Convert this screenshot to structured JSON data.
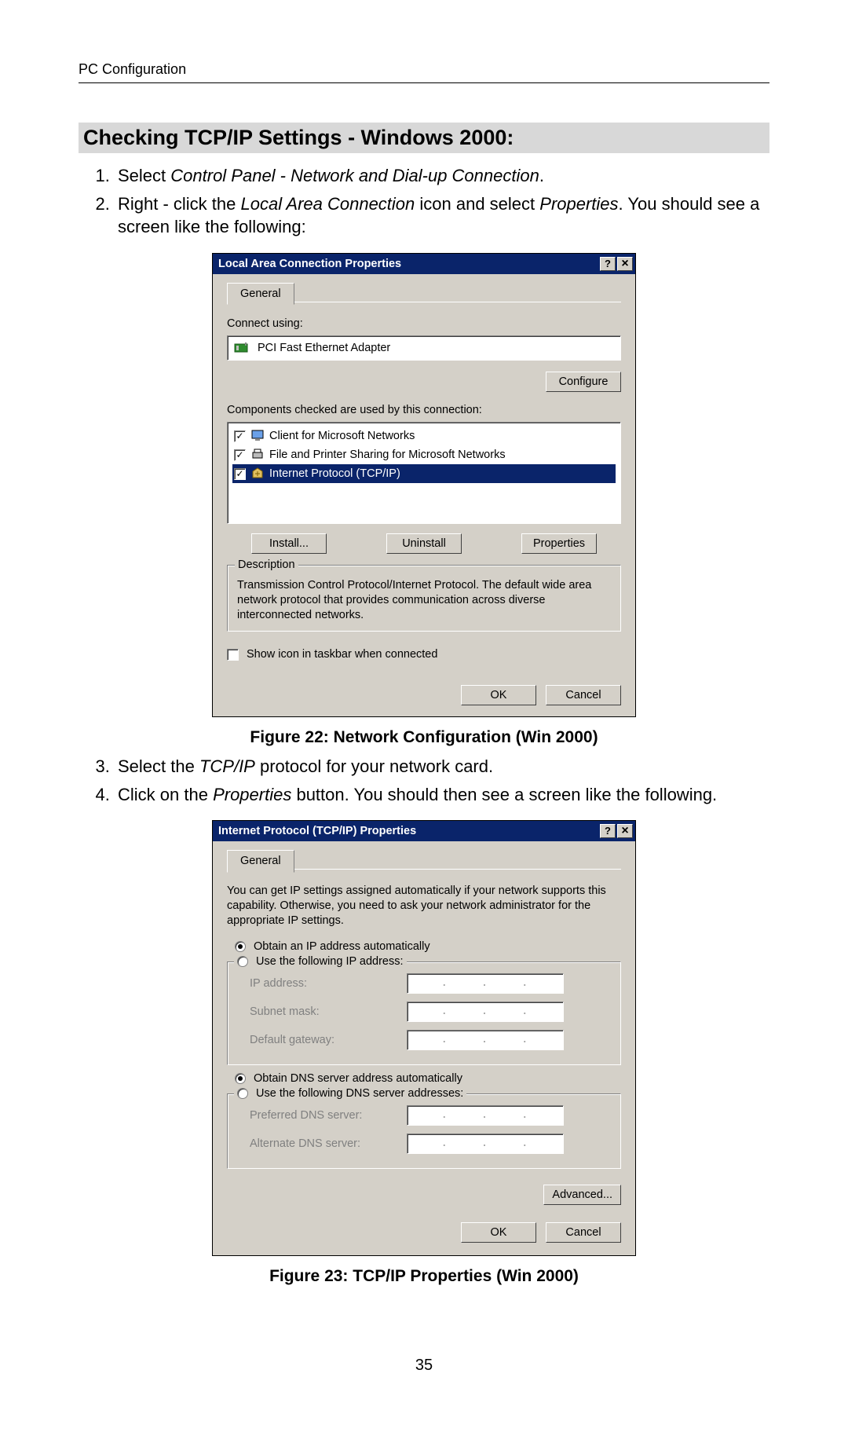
{
  "header": {
    "running": "PC Configuration"
  },
  "heading": "Checking TCP/IP Settings - Windows 2000:",
  "steps1": {
    "s1a": "Select ",
    "s1b": "Control Panel - Network and Dial-up Connection",
    "s1c": ".",
    "s2a": "Right - click the ",
    "s2b": "Local Area Connection",
    "s2c": " icon and select ",
    "s2d": "Properties",
    "s2e": ". You should see a screen like the following:"
  },
  "fig22": "Figure 22: Network Configuration (Win 2000)",
  "steps2": {
    "s3a": "Select the ",
    "s3b": "TCP/IP",
    "s3c": " protocol for your network card.",
    "s4a": "Click on the ",
    "s4b": "Properties",
    "s4c": " button. You should then see a screen like the following."
  },
  "fig23": "Figure 23: TCP/IP Properties (Win 2000)",
  "pagenum": "35",
  "dlg1": {
    "title": "Local Area Connection Properties",
    "tab": "General",
    "connectUsing": "Connect using:",
    "adapter": "PCI Fast Ethernet Adapter",
    "configure": "Configure",
    "componentsLabel": "Components checked are used by this connection:",
    "items": {
      "a": "Client for Microsoft Networks",
      "b": "File and Printer Sharing for Microsoft Networks",
      "c": "Internet Protocol (TCP/IP)"
    },
    "install": "Install...",
    "uninstall": "Uninstall",
    "properties": "Properties",
    "descLegend": "Description",
    "descText": "Transmission Control Protocol/Internet Protocol. The default wide area network protocol that provides communication across diverse interconnected networks.",
    "showIcon": "Show icon in taskbar when connected",
    "ok": "OK",
    "cancel": "Cancel"
  },
  "dlg2": {
    "title": "Internet Protocol (TCP/IP) Properties",
    "tab": "General",
    "intro": "You can get IP settings assigned automatically if your network supports this capability. Otherwise, you need to ask your network administrator for the appropriate IP settings.",
    "r1": "Obtain an IP address automatically",
    "r2": "Use the following IP address:",
    "ip": "IP address:",
    "mask": "Subnet mask:",
    "gw": "Default gateway:",
    "r3": "Obtain DNS server address automatically",
    "r4": "Use the following DNS server addresses:",
    "pdns": "Preferred DNS server:",
    "adns": "Alternate DNS server:",
    "advanced": "Advanced...",
    "ok": "OK",
    "cancel": "Cancel"
  }
}
